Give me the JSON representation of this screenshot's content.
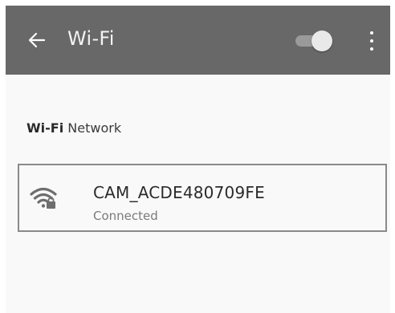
{
  "header": {
    "title": "Wi-Fi",
    "wifi_toggle": "on",
    "back_icon": "back-arrow-icon",
    "menu_icon": "more-vert-icon"
  },
  "section": {
    "prefix": "Wi-Fi",
    "suffix": "Network"
  },
  "network": {
    "name": "CAM_ACDE480709FE",
    "status": "Connected",
    "icon": "wifi-locked-icon"
  },
  "colors": {
    "appbar": "#686868",
    "background": "#f9f9f9",
    "card_border": "#8a8a8a"
  }
}
